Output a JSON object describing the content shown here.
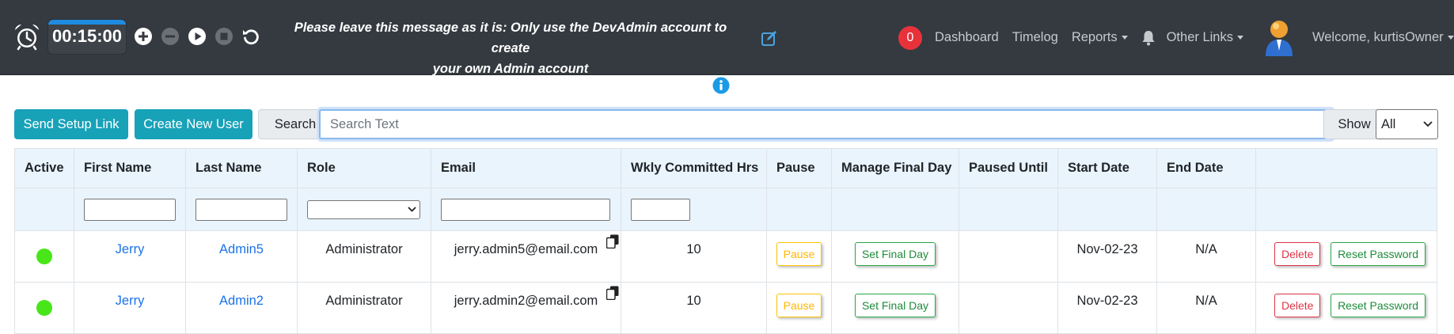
{
  "header": {
    "timer": "00:15:00",
    "timer_progress": 1.0,
    "notice_line1": "Please leave this message as it is: Only use the DevAdmin account to create",
    "notice_line2": "your own Admin account",
    "notification_count": "0",
    "nav": {
      "dashboard": "Dashboard",
      "timelog": "Timelog",
      "reports": "Reports",
      "other_links": "Other Links",
      "welcome": "Welcome, kurtisOwner"
    }
  },
  "actions": {
    "send_setup_link": "Send Setup Link",
    "create_new_user": "Create New User",
    "search_label": "Search",
    "search_placeholder": "Search Text",
    "show_label": "Show",
    "show_value": "All"
  },
  "table": {
    "columns": {
      "active": "Active",
      "first_name": "First Name",
      "last_name": "Last Name",
      "role": "Role",
      "email": "Email",
      "wkly": "Wkly Committed Hrs",
      "pause": "Pause",
      "final_day": "Manage Final Day",
      "paused_until": "Paused Until",
      "start_date": "Start Date",
      "end_date": "End Date"
    },
    "rows": [
      {
        "first_name": "Jerry",
        "last_name": "Admin5",
        "role": "Administrator",
        "email": "jerry.admin5@email.com",
        "wkly": "10",
        "pause": "Pause",
        "final_day": "Set Final Day",
        "paused_until": "",
        "start_date": "Nov-02-23",
        "end_date": "N/A",
        "delete": "Delete",
        "reset": "Reset Password"
      },
      {
        "first_name": "Jerry",
        "last_name": "Admin2",
        "role": "Administrator",
        "email": "jerry.admin2@email.com",
        "wkly": "10",
        "pause": "Pause",
        "final_day": "Set Final Day",
        "paused_until": "",
        "start_date": "Nov-02-23",
        "end_date": "N/A",
        "delete": "Delete",
        "reset": "Reset Password"
      }
    ]
  },
  "colors": {
    "header_bg": "#343a40",
    "teal": "#17a2b8",
    "active_green": "#48e619",
    "link_blue": "#1a73e8",
    "badge_red": "#e8323b"
  }
}
